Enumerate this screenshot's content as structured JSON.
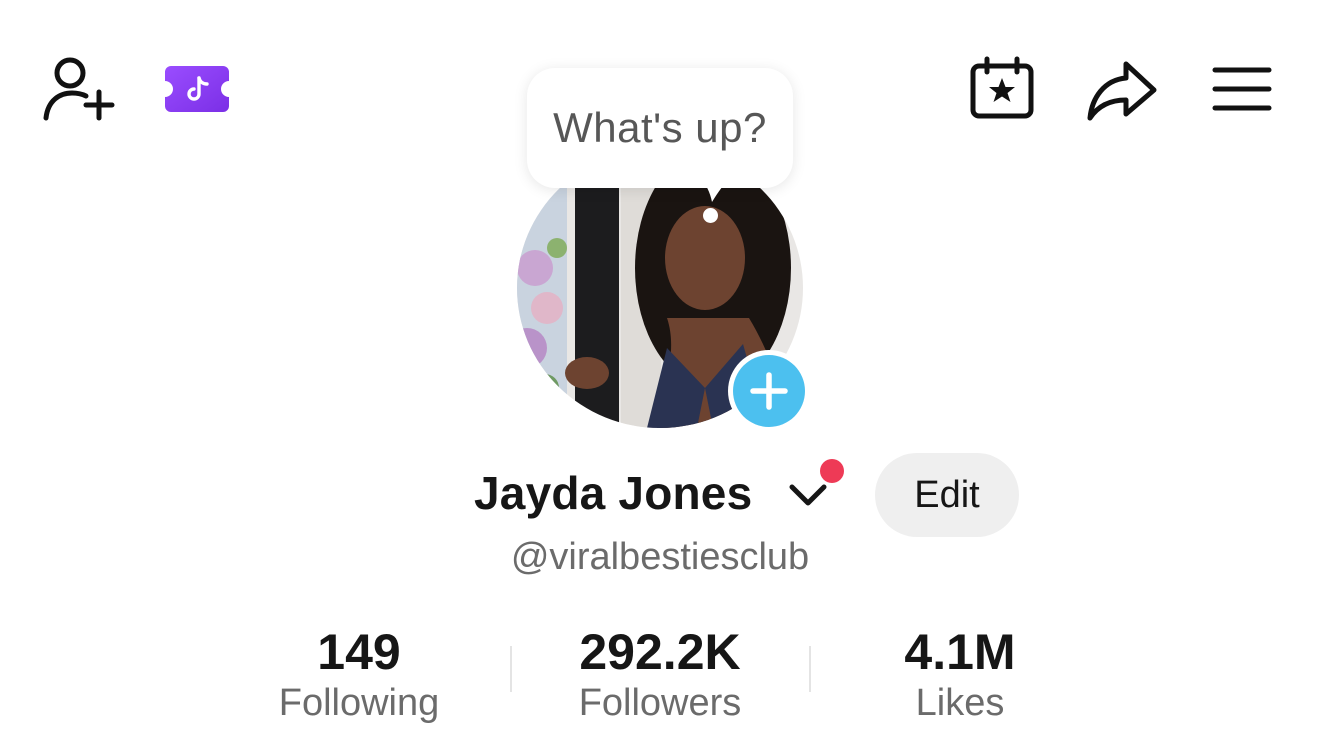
{
  "top_bar": {
    "icons": {
      "add_friend": "person-add-icon",
      "promo": "tiktok-ticket-icon",
      "events": "calendar-star-icon",
      "share": "share-arrow-icon",
      "menu": "hamburger-menu-icon"
    },
    "promo_color": "#8b3df2"
  },
  "status_bubble": {
    "text": "What's up?"
  },
  "profile": {
    "display_name": "Jayda Jones",
    "username": "@viralbestiesclub",
    "edit_label": "Edit",
    "notification_dot_color": "#ee3a56",
    "add_story_color": "#4cc0ef"
  },
  "stats": [
    {
      "value": "149",
      "label": "Following"
    },
    {
      "value": "292.2K",
      "label": "Followers"
    },
    {
      "value": "4.1M",
      "label": "Likes"
    }
  ]
}
